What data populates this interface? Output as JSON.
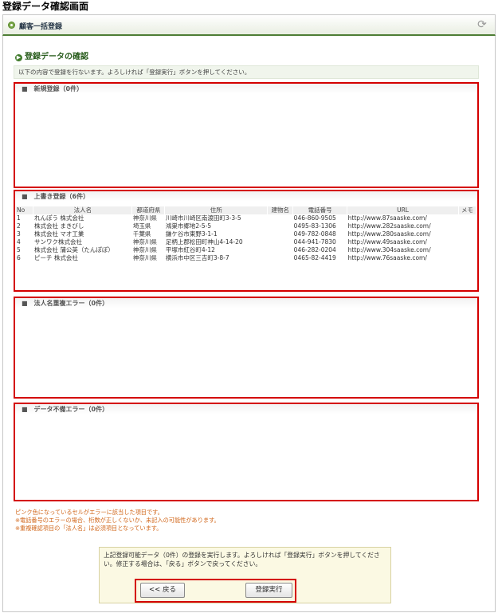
{
  "page": {
    "title": "登録データ確認画面"
  },
  "header": {
    "label": "顧客一括登録",
    "refresh_icon": "refresh-icon"
  },
  "section": {
    "heading": "登録データの確認"
  },
  "notice": "以下の内容で登録を行ないます。よろしければ「登録実行」ボタンを押してください。",
  "panels": {
    "new": {
      "title": "■　新規登録（0件）"
    },
    "overwrite": {
      "title": "■　上書き登録（6件）",
      "columns": [
        "No",
        "法人名",
        "都道府県",
        "住所",
        "建物名",
        "電話番号",
        "URL",
        "メモ"
      ],
      "rows": [
        {
          "no": "1",
          "name": "れんぽう 株式会社",
          "pref": "神奈川県",
          "address": "川崎市川崎区南渡田町3-3-5",
          "building": "",
          "tel": "046-860-9505",
          "url": "http://www.87saaske.com/",
          "memo": ""
        },
        {
          "no": "2",
          "name": "株式会社 まきびし",
          "pref": "埼玉県",
          "address": "鴻巣市郷地2-5-5",
          "building": "",
          "tel": "0495-83-1306",
          "url": "http://www.282saaske.com/",
          "memo": ""
        },
        {
          "no": "3",
          "name": "株式会社 マオ工業",
          "pref": "千葉県",
          "address": "鎌ケ谷市東野3-1-1",
          "building": "",
          "tel": "049-782-0848",
          "url": "http://www.280saaske.com/",
          "memo": ""
        },
        {
          "no": "4",
          "name": "サンワク株式会社",
          "pref": "神奈川県",
          "address": "足柄上郡松田町神山4-14-20",
          "building": "",
          "tel": "044-941-7830",
          "url": "http://www.49saaske.com/",
          "memo": ""
        },
        {
          "no": "5",
          "name": "株式会社 蒲公英（たんぽぽ）",
          "pref": "神奈川県",
          "address": "平塚市紅谷町4-12",
          "building": "",
          "tel": "046-282-0204",
          "url": "http://www.304saaske.com/",
          "memo": ""
        },
        {
          "no": "6",
          "name": "ピーチ 株式会社",
          "pref": "神奈川県",
          "address": "横浜市中区三吉町3-8-7",
          "building": "",
          "tel": "0465-82-4419",
          "url": "http://www.76saaske.com/",
          "memo": ""
        }
      ]
    },
    "duplicate": {
      "title": "■　法人名重複エラー（0件）"
    },
    "invalid": {
      "title": "■　データ不備エラー（0件）"
    }
  },
  "footnotes": [
    "ピンク色になっているセルがエラーに該当した項目です。",
    "※電話番号のエラーの場合、桁数が正しくないか、未記入の可能性があります。",
    "※重複確認項目の「法人名」は必須項目となっています。"
  ],
  "confirm": {
    "message": "上記登録可能データ（0件）の登録を実行します。よろしければ「登録実行」ボタンを押してください。修正する場合は、「戻る」ボタンで戻ってください。",
    "back_label": "<< 戻る",
    "exec_label": "登録実行"
  },
  "colors": {
    "accent_green": "#4e7e35",
    "highlight_red": "#d40000",
    "note_orange": "#d2691e"
  }
}
